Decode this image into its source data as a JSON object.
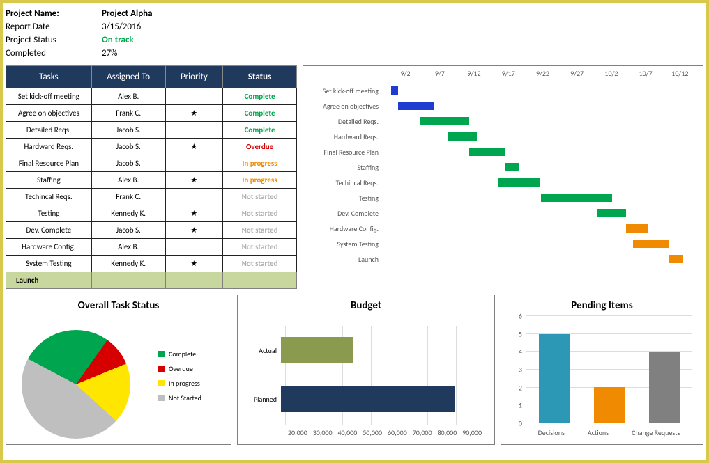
{
  "header": {
    "project_name_lbl": "Project Name:",
    "project_name_val": "Project Alpha",
    "report_date_lbl": "Report Date",
    "report_date_val": "3/15/2016",
    "project_status_lbl": "Project Status",
    "project_status_val": "On track",
    "completed_lbl": "Completed",
    "completed_val": "27%"
  },
  "task_table": {
    "headers": [
      "Tasks",
      "Assigned To",
      "Priority",
      "Status"
    ],
    "launch_label": "Launch",
    "rows": [
      {
        "task": "Set kick-off meeting",
        "assigned": "Alex B.",
        "priority": "",
        "status": "Complete",
        "status_class": "st-complete"
      },
      {
        "task": "Agree on objectives",
        "assigned": "Frank C.",
        "priority": "★",
        "status": "Complete",
        "status_class": "st-complete"
      },
      {
        "task": "Detailed Reqs.",
        "assigned": "Jacob S.",
        "priority": "",
        "status": "Complete",
        "status_class": "st-complete"
      },
      {
        "task": "Hardward Reqs.",
        "assigned": "Jacob S.",
        "priority": "★",
        "status": "Overdue",
        "status_class": "st-overdue"
      },
      {
        "task": "Final Resource Plan",
        "assigned": "Jacob S.",
        "priority": "",
        "status": "In progress",
        "status_class": "st-progress"
      },
      {
        "task": "Staffing",
        "assigned": "Alex B.",
        "priority": "★",
        "status": "In progress",
        "status_class": "st-progress"
      },
      {
        "task": "Techincal Reqs.",
        "assigned": "Frank C.",
        "priority": "",
        "status": "Not started",
        "status_class": "st-notstarted"
      },
      {
        "task": "Testing",
        "assigned": "Kennedy K.",
        "priority": "★",
        "status": "Not started",
        "status_class": "st-notstarted"
      },
      {
        "task": "Dev. Complete",
        "assigned": "Jacob S.",
        "priority": "★",
        "status": "Not started",
        "status_class": "st-notstarted"
      },
      {
        "task": "Hardware Config.",
        "assigned": "Alex B.",
        "priority": "",
        "status": "Not started",
        "status_class": "st-notstarted"
      },
      {
        "task": "System Testing",
        "assigned": "Kennedy K.",
        "priority": "★",
        "status": "Not started",
        "status_class": "st-notstarted"
      }
    ]
  },
  "chart_data": [
    {
      "type": "bar",
      "id": "gantt",
      "title": "",
      "x_ticks": [
        "9/2",
        "9/7",
        "9/12",
        "9/17",
        "9/22",
        "9/27",
        "10/2",
        "10/7",
        "10/12"
      ],
      "x_min": 0,
      "x_max": 44,
      "tasks": [
        {
          "label": "Set kick-off meeting",
          "start": 1,
          "dur": 1,
          "color": "c-blue"
        },
        {
          "label": "Agree on objectives",
          "start": 2,
          "dur": 5,
          "color": "c-blue"
        },
        {
          "label": "Detailed Reqs.",
          "start": 5,
          "dur": 7,
          "color": "c-green"
        },
        {
          "label": "Hardward Reqs.",
          "start": 9,
          "dur": 4,
          "color": "c-green"
        },
        {
          "label": "Final Resource Plan",
          "start": 12,
          "dur": 5,
          "color": "c-green"
        },
        {
          "label": "Staffing",
          "start": 17,
          "dur": 2,
          "color": "c-green"
        },
        {
          "label": "Techincal Reqs.",
          "start": 16,
          "dur": 6,
          "color": "c-green"
        },
        {
          "label": "Testing",
          "start": 22,
          "dur": 10,
          "color": "c-green"
        },
        {
          "label": "Dev. Complete",
          "start": 30,
          "dur": 4,
          "color": "c-green"
        },
        {
          "label": "Hardware Config.",
          "start": 34,
          "dur": 3,
          "color": "c-orange"
        },
        {
          "label": "System Testing",
          "start": 35,
          "dur": 5,
          "color": "c-orange"
        },
        {
          "label": "Launch",
          "start": 40,
          "dur": 2,
          "color": "c-orange"
        }
      ]
    },
    {
      "type": "pie",
      "id": "overall_status",
      "title": "Overall Task Status",
      "slices": [
        {
          "label": "Complete",
          "value": 27,
          "color": "#00a64f"
        },
        {
          "label": "Overdue",
          "value": 9,
          "color": "#d60000"
        },
        {
          "label": "In progress",
          "value": 18,
          "color": "#ffe600"
        },
        {
          "label": "Not Started",
          "value": 46,
          "color": "#bfbfbf"
        }
      ]
    },
    {
      "type": "bar",
      "id": "budget",
      "title": "Budget",
      "orientation": "horizontal",
      "xlabel": "",
      "ylabel": "",
      "xlim": [
        20000,
        90000
      ],
      "x_ticks": [
        "20,000",
        "30,000",
        "40,000",
        "50,000",
        "60,000",
        "70,000",
        "80,000",
        "90,000"
      ],
      "series": [
        {
          "name": "Actual",
          "value": 45000,
          "color": "#8a9a4f"
        },
        {
          "name": "Planned",
          "value": 80000,
          "color": "#203a5e"
        }
      ]
    },
    {
      "type": "bar",
      "id": "pending",
      "title": "Pending Items",
      "ylim": [
        0,
        6
      ],
      "y_ticks": [
        0,
        1,
        2,
        3,
        4,
        5,
        6
      ],
      "categories": [
        "Decisions",
        "Actions",
        "Change Requests"
      ],
      "values": [
        5,
        2,
        4
      ],
      "colors": [
        "#2d98b5",
        "#f08a00",
        "#808080"
      ]
    }
  ]
}
